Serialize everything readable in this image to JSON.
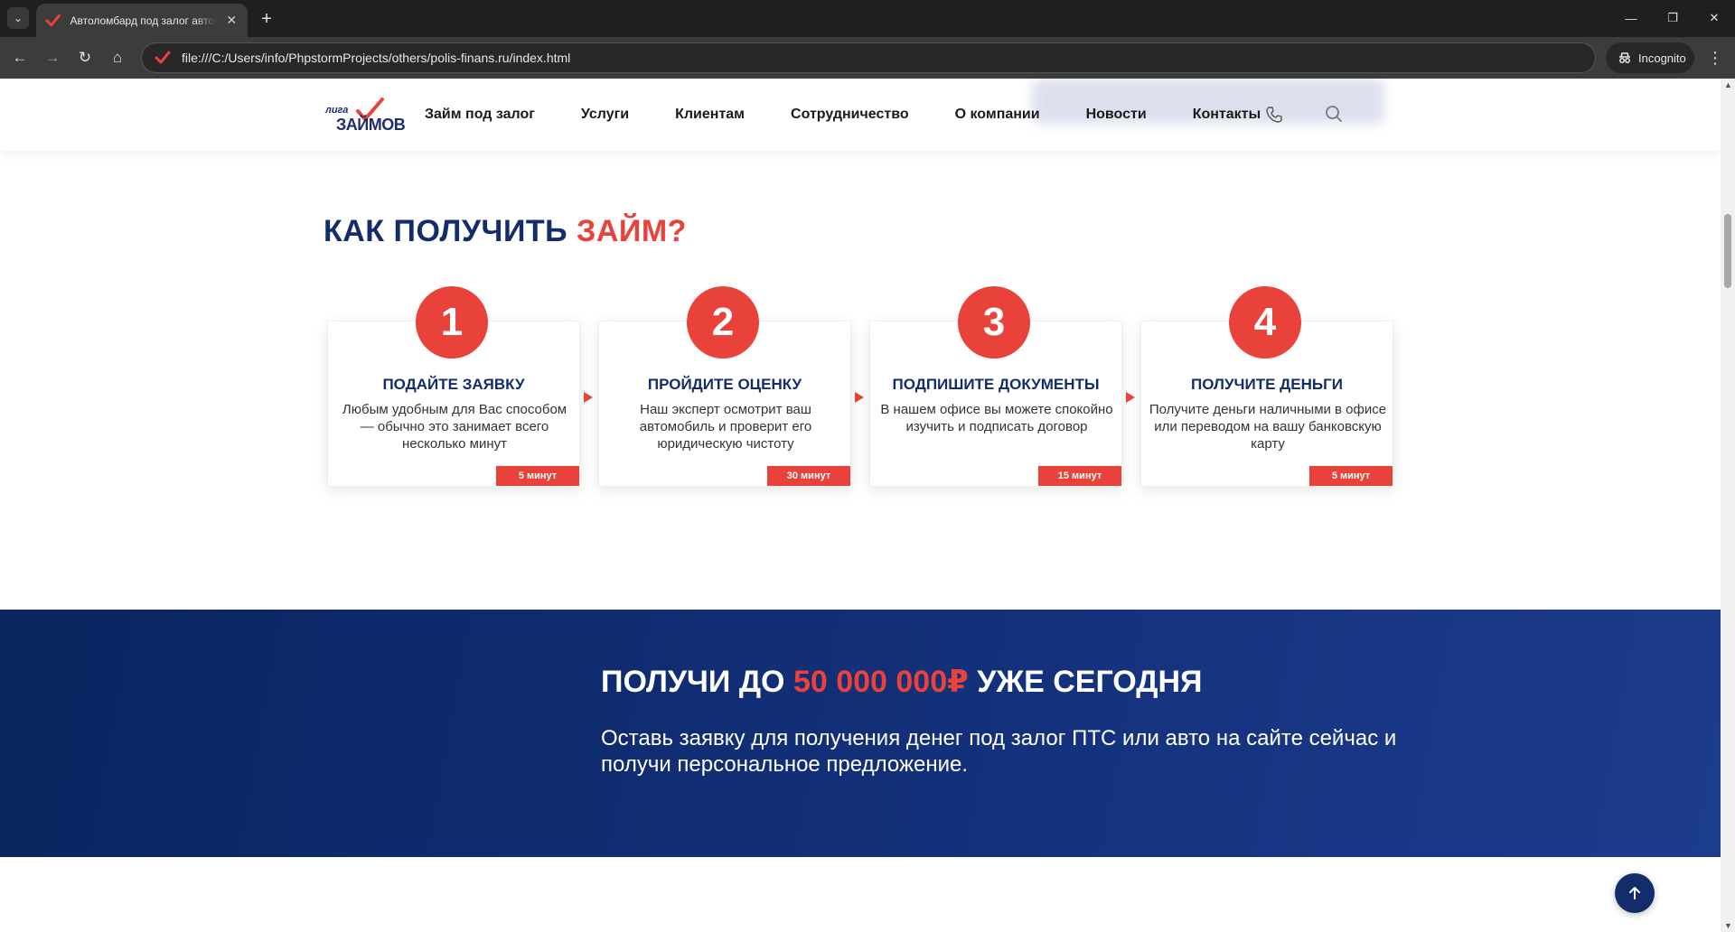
{
  "browser": {
    "tab_title": "Автоломбард под залог автомобиля",
    "tab_close": "✕",
    "new_tab": "+",
    "url": "file:///C:/Users/info/PhpstormProjects/others/polis-finans.ru/index.html",
    "incognito_label": "Incognito",
    "controls": {
      "minimize": "—",
      "maximize": "❐",
      "close": "✕"
    },
    "nav": {
      "back": "←",
      "forward": "→",
      "reload": "↻",
      "home": "⌂",
      "menu": "⋮",
      "tab_list": "⌄"
    }
  },
  "header": {
    "logo": {
      "top": "лига",
      "bottom": "ЗАЙМОВ"
    },
    "nav_items": [
      "Займ под залог",
      "Услуги",
      "Клиентам",
      "Сотрудничество",
      "О компании",
      "Новости",
      "Контакты"
    ]
  },
  "steps_section": {
    "title_dark": "КАК ПОЛУЧИТЬ",
    "title_red": "ЗАЙМ?",
    "steps": [
      {
        "number": "1",
        "heading": "ПОДАЙТЕ ЗАЯВКУ",
        "text": "Любым удобным для Вас способом — обычно это занимает всего несколько минут",
        "badge": "5 минут"
      },
      {
        "number": "2",
        "heading": "ПРОЙДИТЕ ОЦЕНКУ",
        "text": "Наш эксперт осмотрит ваш автомобиль и проверит его юридическую чистоту",
        "badge": "30 минут"
      },
      {
        "number": "3",
        "heading": "ПОДПИШИТЕ ДОКУМЕНТЫ",
        "text": "В нашем офисе вы можете спокойно изучить и подписать договор",
        "badge": "15 минут"
      },
      {
        "number": "4",
        "heading": "ПОЛУЧИТЕ ДЕНЬГИ",
        "text": "Получите деньги наличными в офисе или переводом на вашу банковскую карту",
        "badge": "5 минут"
      }
    ]
  },
  "banner": {
    "title_before": "ПОЛУЧИ ДО ",
    "title_amount": "50 000 000₽",
    "title_after": " УЖЕ СЕГОДНЯ",
    "text": "Оставь заявку для получения денег под залог ПТС или авто на сайте сейчас и получи персональное предложение."
  },
  "colors": {
    "brand_blue": "#132d6c",
    "accent_red": "#e9423a"
  }
}
